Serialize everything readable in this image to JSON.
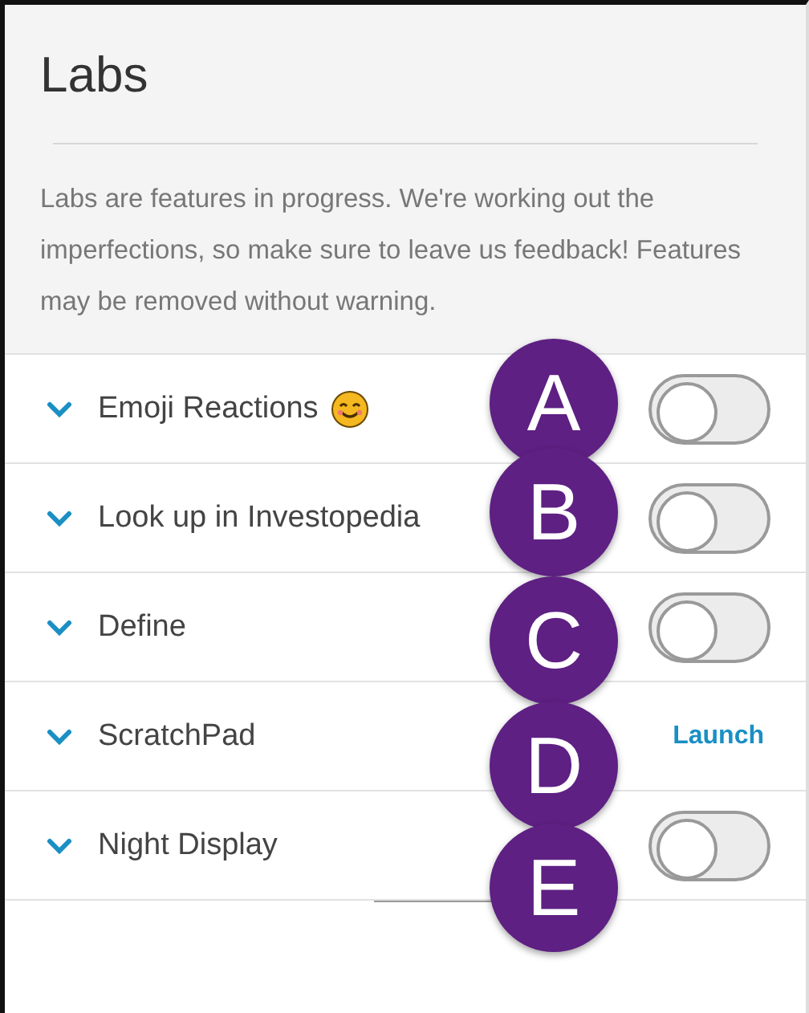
{
  "title": "Labs",
  "description": "Labs are features in progress. We're working out the imperfections, so make sure to leave us feedback! Features may be removed without warning.",
  "features": [
    {
      "label": "Emoji Reactions",
      "expanded": false,
      "emoji": true,
      "control": {
        "kind": "toggle",
        "on": false
      },
      "callout": "A"
    },
    {
      "label": "Look up in Investopedia",
      "expanded": false,
      "emoji": false,
      "control": {
        "kind": "toggle",
        "on": false
      },
      "callout": "B"
    },
    {
      "label": "Define",
      "expanded": false,
      "emoji": false,
      "control": {
        "kind": "toggle",
        "on": false
      },
      "callout": "C"
    },
    {
      "label": "ScratchPad",
      "expanded": false,
      "emoji": false,
      "control": {
        "kind": "link",
        "label": "Launch"
      },
      "callout": "D"
    },
    {
      "label": "Night Display",
      "expanded": false,
      "emoji": false,
      "control": {
        "kind": "toggle",
        "on": false
      },
      "callout": "E"
    }
  ]
}
